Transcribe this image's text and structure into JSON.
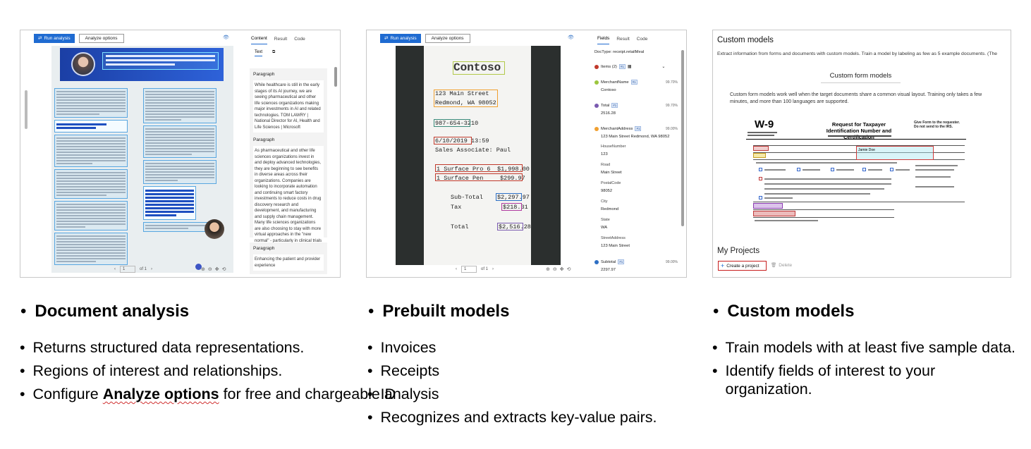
{
  "panel1": {
    "run_analysis": "Run analysis",
    "analyze_options": "Analyze options",
    "tabs": [
      "Content",
      "Result",
      "Code"
    ],
    "sub_tabs": [
      "Text"
    ],
    "paragraphs": [
      {
        "label": "Paragraph",
        "text": "While healthcare is still in the early stages of its AI journey, we are seeing pharmaceutical and other life sciences organizations making major investments in AI and related technologies. TOM LAWRY | National Director for AI, Health and Life Sciences | Microsoft"
      },
      {
        "label": "Paragraph",
        "text": "As pharmaceutical and other life sciences organizations invest in and deploy advanced technologies, they are beginning to see benefits in diverse areas across their organizations. Companies are looking to incorporate automation and continuing smart factory investments to reduce costs in drug discovery research and development, and manufacturing and supply chain management. Many life sciences organizations are also choosing to stay with more virtual approaches in the \"new normal\" - particularly in clinical trials and sales and marketing areas."
      },
      {
        "label": "Paragraph",
        "text": "Enhancing the patient and provider experience"
      }
    ],
    "page_current": "1",
    "page_total": "of 1"
  },
  "panel2": {
    "run_analysis": "Run analysis",
    "analyze_options": "Analyze options",
    "tabs": [
      "Fields",
      "Result",
      "Code"
    ],
    "doctype": "DocType:  receipt.retailMeal",
    "receipt": {
      "brand": "Contoso",
      "addr1": "123 Main Street",
      "addr2": "Redmond, WA 98052",
      "phone": "987-654-3210",
      "date": "6/10/2019 13:59",
      "associate": "Sales Associate: Paul",
      "item1": "1 Surface Pro 6",
      "item1_price": "$1,998.00",
      "item2": "1 Surface Pen",
      "item2_price": "$299.97",
      "subtotal_label": "Sub-Total",
      "subtotal": "$2,297.97",
      "tax_label": "Tax",
      "tax": "$218.31",
      "total_label": "Total",
      "total": "$2,516.28"
    },
    "fields": {
      "items": "Items (2)",
      "merchant_name_label": "MerchantName",
      "merchant_name": "Contoso",
      "merchant_name_pct": "99.70%",
      "total_label": "Total",
      "total": "2516.28",
      "total_pct": "99.70%",
      "merchant_address_label": "MerchantAddress",
      "merchant_address": "123 Main Street Redmond, WA 98052",
      "merchant_address_pct": "99.00%",
      "house_number_label": "HouseNumber",
      "house_number": "123",
      "road_label": "Road",
      "road": "Main Street",
      "postal_label": "PostalCode",
      "postal": "98052",
      "city_label": "City",
      "city": "Redmond",
      "state_label": "State",
      "state": "WA",
      "street_label": "StreetAddress",
      "street": "123 Main Street",
      "subtotal_label": "Subtotal",
      "subtotal": "2297.97",
      "subtotal_pct": "99.00%",
      "tag": "#1"
    },
    "page_current": "1",
    "page_total": "of 1"
  },
  "panel3": {
    "title": "Custom models",
    "desc": "Extract information from forms and documents with custom models. Train a model by labeling as few as 5 example documents. (The",
    "section_title": "Custom form models",
    "section_desc": "Custom form models work well when the target documents share a common visual layout. Training only takes a few minutes, and more than 100 languages are supported.",
    "w9_big": "W-9",
    "w9_title": "Request for Taxpayer Identification Number and Certification",
    "w9_right": "Give Form to the requester. Do not send to the IRS.",
    "w9_name": "Jamie Doe",
    "my_projects": "My Projects",
    "create_project": "Create a project",
    "delete": "Delete"
  },
  "bullets": [
    {
      "heading": "Document analysis",
      "items": [
        "Returns structured data representations.",
        "Regions of interest and relationships."
      ],
      "last_pre": "Configure ",
      "last_bold": "Analyze options",
      "last_post": " for free and chargeable analysis"
    },
    {
      "heading": "Prebuilt models",
      "items": [
        "Invoices",
        "Receipts",
        "ID",
        "Recognizes and extracts key-value pairs."
      ]
    },
    {
      "heading": "Custom models",
      "items": [
        "Train models with at least five sample data.",
        "Identify fields of interest to your organization."
      ]
    }
  ],
  "colors": {
    "accent": "#1f6bd1",
    "highlight_red": "#c81e1e"
  }
}
